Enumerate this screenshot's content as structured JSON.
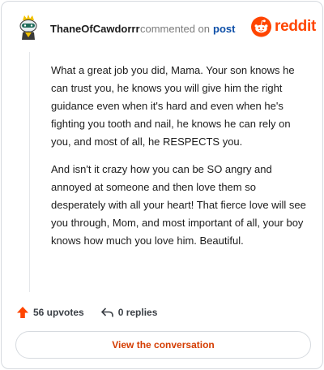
{
  "header": {
    "author": "ThaneOfCawdorrr",
    "action_text": "commented on",
    "post_link": "post",
    "brand": "reddit"
  },
  "comment": {
    "paragraphs": [
      "What a great job you did, Mama. Your son knows he can trust you, he knows you will give him the right guidance even when it's hard and even when he's fighting you tooth and nail, he knows he can rely on you, and most of all, he RESPECTS you.",
      "And isn't it crazy how you can be SO angry and annoyed at someone and then love them so desperately with all your heart! That fierce love will see you through, Mom, and most important of all, your boy knows how much you love him. Beautiful."
    ]
  },
  "actions": {
    "upvotes": "56 upvotes",
    "replies": "0 replies"
  },
  "cta": {
    "label": "View the conversation"
  },
  "colors": {
    "brand": "#ff4500",
    "link": "#0e4fa8",
    "cta_text": "#d43c00"
  },
  "icons": [
    "avatar",
    "reddit-snoo-icon",
    "upvote-arrow-icon",
    "reply-arrow-icon"
  ]
}
